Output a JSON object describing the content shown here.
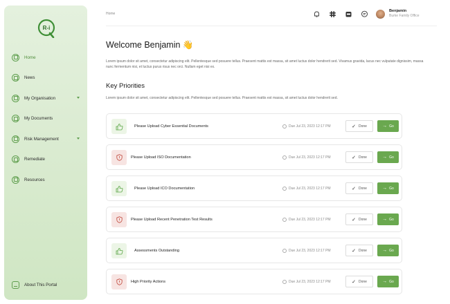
{
  "sidebar": {
    "logo_text": "R-i",
    "items": [
      {
        "label": "Home",
        "icon": "home-icon",
        "active": true,
        "expandable": false
      },
      {
        "label": "News",
        "icon": "news-icon",
        "active": false,
        "expandable": false
      },
      {
        "label": "My Organisation",
        "icon": "organisation-icon",
        "active": false,
        "expandable": true
      },
      {
        "label": "My Documents",
        "icon": "documents-icon",
        "active": false,
        "expandable": false
      },
      {
        "label": "Risk Management",
        "icon": "risk-icon",
        "active": false,
        "expandable": true
      },
      {
        "label": "Remediate",
        "icon": "remediate-icon",
        "active": false,
        "expandable": false
      },
      {
        "label": "Resources",
        "icon": "resources-icon",
        "active": false,
        "expandable": false
      }
    ],
    "bottom": {
      "label": "About This Portal",
      "icon": "monitor-icon"
    }
  },
  "topbar": {
    "breadcrumb": "Home",
    "user_name": "Benjamin",
    "user_org": "Burke Family Office",
    "icons": [
      "bell-icon",
      "slack-icon",
      "calendar-icon",
      "chat-icon"
    ]
  },
  "main": {
    "welcome": "Welcome Benjamin 👋",
    "intro": "Lorem ipsum dolor sit amet, consectetur adipiscing elit. Pellentesque sed posuere tellus. Praesent mattis est massa, sit amet luctus dolor hendrerit sed. Vivamus gravida, lacus nec vulputate dignissim, massa nunc fermentum nisi, et luctus purus risus nec orci. Nullam eget nisi ex.",
    "priorities_title": "Key Priorities",
    "priorities_intro": "Lorem ipsum dolor sit amet, consectetur adipiscing elit. Pellentesque sed posuere tellus. Praesent mattis est massa, sit amet luctus dolor hendrerit sed.",
    "done_label": "Done",
    "go_label": "Go",
    "priorities": [
      {
        "title": "Please Upload Cyber Essential Documents",
        "due": "Due Jul 23, 2023 12:17 PM",
        "icon": "thumbs-up-icon",
        "tone": "green"
      },
      {
        "title": "Please Upload ISO Documentation",
        "due": "Due Jul 23, 2023 12:17 PM",
        "icon": "shield-icon",
        "tone": "red"
      },
      {
        "title": "Please Upload ICO Documentation",
        "due": "Due Jul 23, 2023 12:17 PM",
        "icon": "thumbs-up-icon",
        "tone": "green"
      },
      {
        "title": "Please Upload Recent Penetration Test Results",
        "due": "Due Jul 23, 2023 12:17 PM",
        "icon": "shield-icon",
        "tone": "red"
      },
      {
        "title": "Assessments Outstanding",
        "due": "Due Jul 23, 2023 12:17 PM",
        "icon": "thumbs-up-icon",
        "tone": "green"
      },
      {
        "title": "High Priority Actions",
        "due": "Due Jul 23, 2023 12:17 PM",
        "icon": "shield-icon",
        "tone": "red"
      }
    ]
  },
  "colors": {
    "accent": "#6aa84f",
    "sidebar_bg": "#dcecd3",
    "danger_bg": "#f7e4e2",
    "success_bg": "#ecf5e6"
  }
}
